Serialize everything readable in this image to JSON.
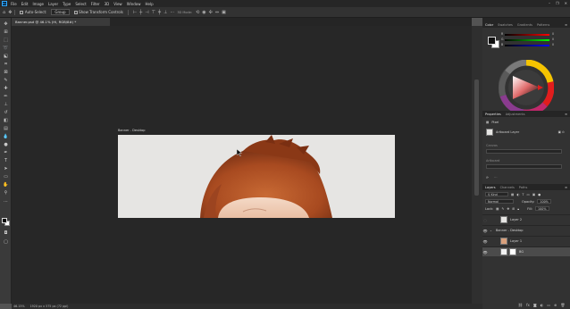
{
  "menubar": {
    "logo": "Ps",
    "items": [
      "File",
      "Edit",
      "Image",
      "Layer",
      "Type",
      "Select",
      "Filter",
      "3D",
      "View",
      "Window",
      "Help"
    ],
    "window_controls": [
      "–",
      "❐",
      "✕"
    ]
  },
  "options_bar": {
    "auto_select_label": "Auto-Select:",
    "auto_select_value": "Group",
    "show_transform_label": "Show Transform Controls",
    "mode_3d_label": "3D Mode:"
  },
  "document_tab": {
    "title": "Banner.psd @ 46.1% (Hi, RGB/8#) *"
  },
  "artboard": {
    "label": "Banner - Desktop"
  },
  "status_bar": {
    "zoom": "46.15%",
    "doc_info": "1920 px x 575 px (72 ppi)"
  },
  "color_panel": {
    "tabs": [
      "Color",
      "Swatches",
      "Gradients",
      "Patterns"
    ],
    "sliders": [
      {
        "label": "R",
        "value": "0"
      },
      {
        "label": "G",
        "value": "0"
      },
      {
        "label": "B",
        "value": "0"
      }
    ],
    "colors": {
      "foreground": "#111111",
      "background": "#ffffff",
      "accent": "#31a8ff"
    }
  },
  "properties_panel": {
    "tabs": [
      "Properties",
      "Adjustments"
    ],
    "kind": "Pixel",
    "label": "Artboard Layer",
    "sub_labels": [
      "Canvas",
      "Artboard"
    ]
  },
  "layers_panel": {
    "tabs": [
      "Layers",
      "Channels",
      "Paths"
    ],
    "filter_kind": "Kind",
    "blend_mode": "Normal",
    "opacity_label": "Opacity:",
    "opacity": "100%",
    "lock_label": "Lock:",
    "fill_label": "Fill:",
    "fill": "100%",
    "layers": [
      {
        "name": "Layer 2",
        "visible": false,
        "indent": 0
      },
      {
        "name": "Banner - Desktop",
        "visible": true,
        "indent": 0,
        "artboard": true
      },
      {
        "name": "Layer 1",
        "visible": true,
        "indent": 1
      },
      {
        "name": "BG",
        "visible": true,
        "indent": 1,
        "selected": true
      }
    ],
    "footer_icons": [
      "link-icon",
      "fx-icon",
      "mask-icon",
      "adjustment-icon",
      "folder-icon",
      "new-layer-icon",
      "trash-icon"
    ]
  },
  "toolbar": {
    "tools": [
      "move-icon",
      "artboard-icon",
      "marquee-icon",
      "lasso-icon",
      "object-select-icon",
      "crop-icon",
      "frame-icon",
      "eyedropper-icon",
      "healing-icon",
      "brush-icon",
      "stamp-icon",
      "history-brush-icon",
      "eraser-icon",
      "gradient-icon",
      "blur-icon",
      "dodge-icon",
      "pen-icon",
      "type-icon",
      "path-select-icon",
      "shape-icon",
      "hand-icon",
      "zoom-icon",
      "more-icon"
    ]
  }
}
